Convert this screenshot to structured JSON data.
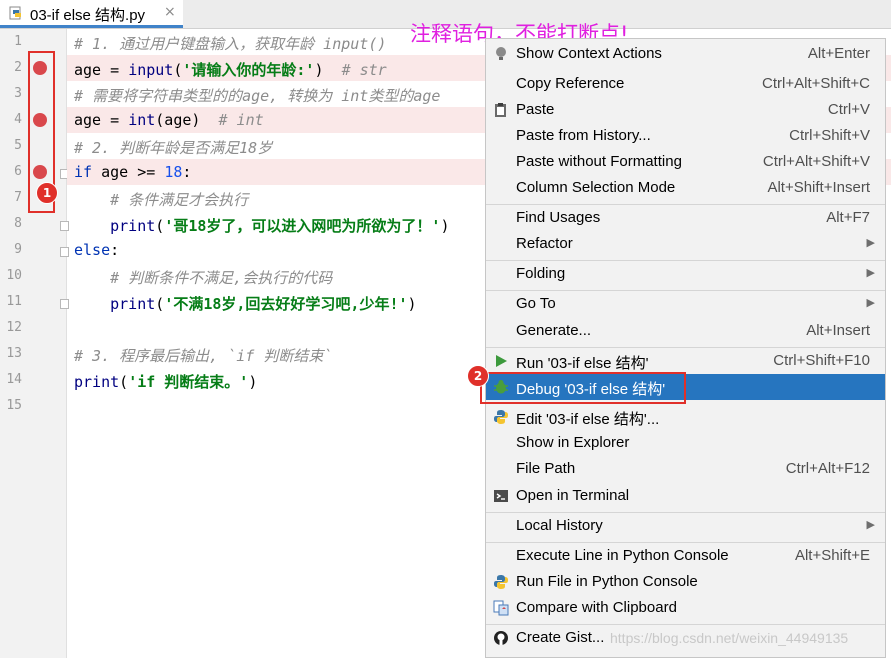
{
  "tab": {
    "title": "03-if else 结构.py",
    "close": "×"
  },
  "annotation": "注释语句，不能打断点!",
  "badges": {
    "one": "1",
    "two": "2"
  },
  "watermark": "https://blog.csdn.net/weixin_44949135",
  "line_numbers": [
    "1",
    "2",
    "3",
    "4",
    "5",
    "6",
    "7",
    "8",
    "9",
    "10",
    "11",
    "12",
    "13",
    "14",
    "15"
  ],
  "breakpoint_lines": [
    2,
    4,
    6
  ],
  "code": {
    "l1": "# 1. 通过用户键盘输入，获取年龄 input()",
    "l2_a": "age = ",
    "l2_b": "input",
    "l2_c": "(",
    "l2_d": "'请输入你的年龄:'",
    "l2_e": ")  ",
    "l2_f": "# str",
    "l3": "# 需要将字符串类型的的age, 转换为 int类型的age",
    "l4_a": "age = ",
    "l4_b": "int",
    "l4_c": "(age)  ",
    "l4_d": "# int",
    "l5": "# 2. 判断年龄是否满足18岁",
    "l6_a": "if",
    "l6_b": " age >= ",
    "l6_c": "18",
    "l6_d": ":",
    "l7": "    # 条件满足才会执行",
    "l8_a": "    ",
    "l8_b": "print",
    "l8_c": "(",
    "l8_d": "'哥18岁了，可以进入网吧为所欲为了！'",
    "l8_e": ")",
    "l9_a": "else",
    "l9_b": ":",
    "l10": "    # 判断条件不满足,会执行的代码",
    "l11_a": "    ",
    "l11_b": "print",
    "l11_c": "(",
    "l11_d": "'不满18岁,回去好好学习吧,少年!'",
    "l11_e": ")",
    "l13": "# 3. 程序最后输出, `if 判断结束`",
    "l14_a": "print",
    "l14_b": "(",
    "l14_c": "'if 判断结束。'",
    "l14_d": ")"
  },
  "menu": [
    {
      "label": "Show Context Actions",
      "shortcut": "Alt+Enter",
      "icon": "lightbulb-icon"
    },
    {
      "label": "Copy Reference",
      "shortcut": "Ctrl+Alt+Shift+C"
    },
    {
      "label": "Paste",
      "shortcut": "Ctrl+V",
      "icon": "paste-icon"
    },
    {
      "label": "Paste from History...",
      "shortcut": "Ctrl+Shift+V"
    },
    {
      "label": "Paste without Formatting",
      "shortcut": "Ctrl+Alt+Shift+V"
    },
    {
      "label": "Column Selection Mode",
      "shortcut": "Alt+Shift+Insert"
    },
    {
      "label": "Find Usages",
      "shortcut": "Alt+F7"
    },
    {
      "label": "Refactor",
      "submenu": true
    },
    {
      "label": "Folding",
      "submenu": true
    },
    {
      "label": "Go To",
      "submenu": true
    },
    {
      "label": "Generate...",
      "shortcut": "Alt+Insert"
    },
    {
      "label": "Run '03-if else 结构'",
      "shortcut": "Ctrl+Shift+F10",
      "icon": "run-icon"
    },
    {
      "label": "Debug '03-if else 结构'",
      "shortcut": "",
      "icon": "debug-bug-icon",
      "selected": true
    },
    {
      "label": "Edit '03-if else 结构'...",
      "icon": "python-icon"
    },
    {
      "label": "Show in Explorer"
    },
    {
      "label": "File Path",
      "shortcut": "Ctrl+Alt+F12"
    },
    {
      "label": "Open in Terminal",
      "icon": "terminal-icon"
    },
    {
      "label": "Local History",
      "submenu": true
    },
    {
      "label": "Execute Line in Python Console",
      "shortcut": "Alt+Shift+E"
    },
    {
      "label": "Run File in Python Console",
      "icon": "python-icon"
    },
    {
      "label": "Compare with Clipboard",
      "icon": "compare-icon"
    },
    {
      "label": "Create Gist...",
      "icon": "github-icon"
    }
  ],
  "colors": {
    "selection": "#2675bf",
    "breakpoint": "#d9484c",
    "annotation": "#e020e0",
    "highlight_box": "#e0302a"
  }
}
